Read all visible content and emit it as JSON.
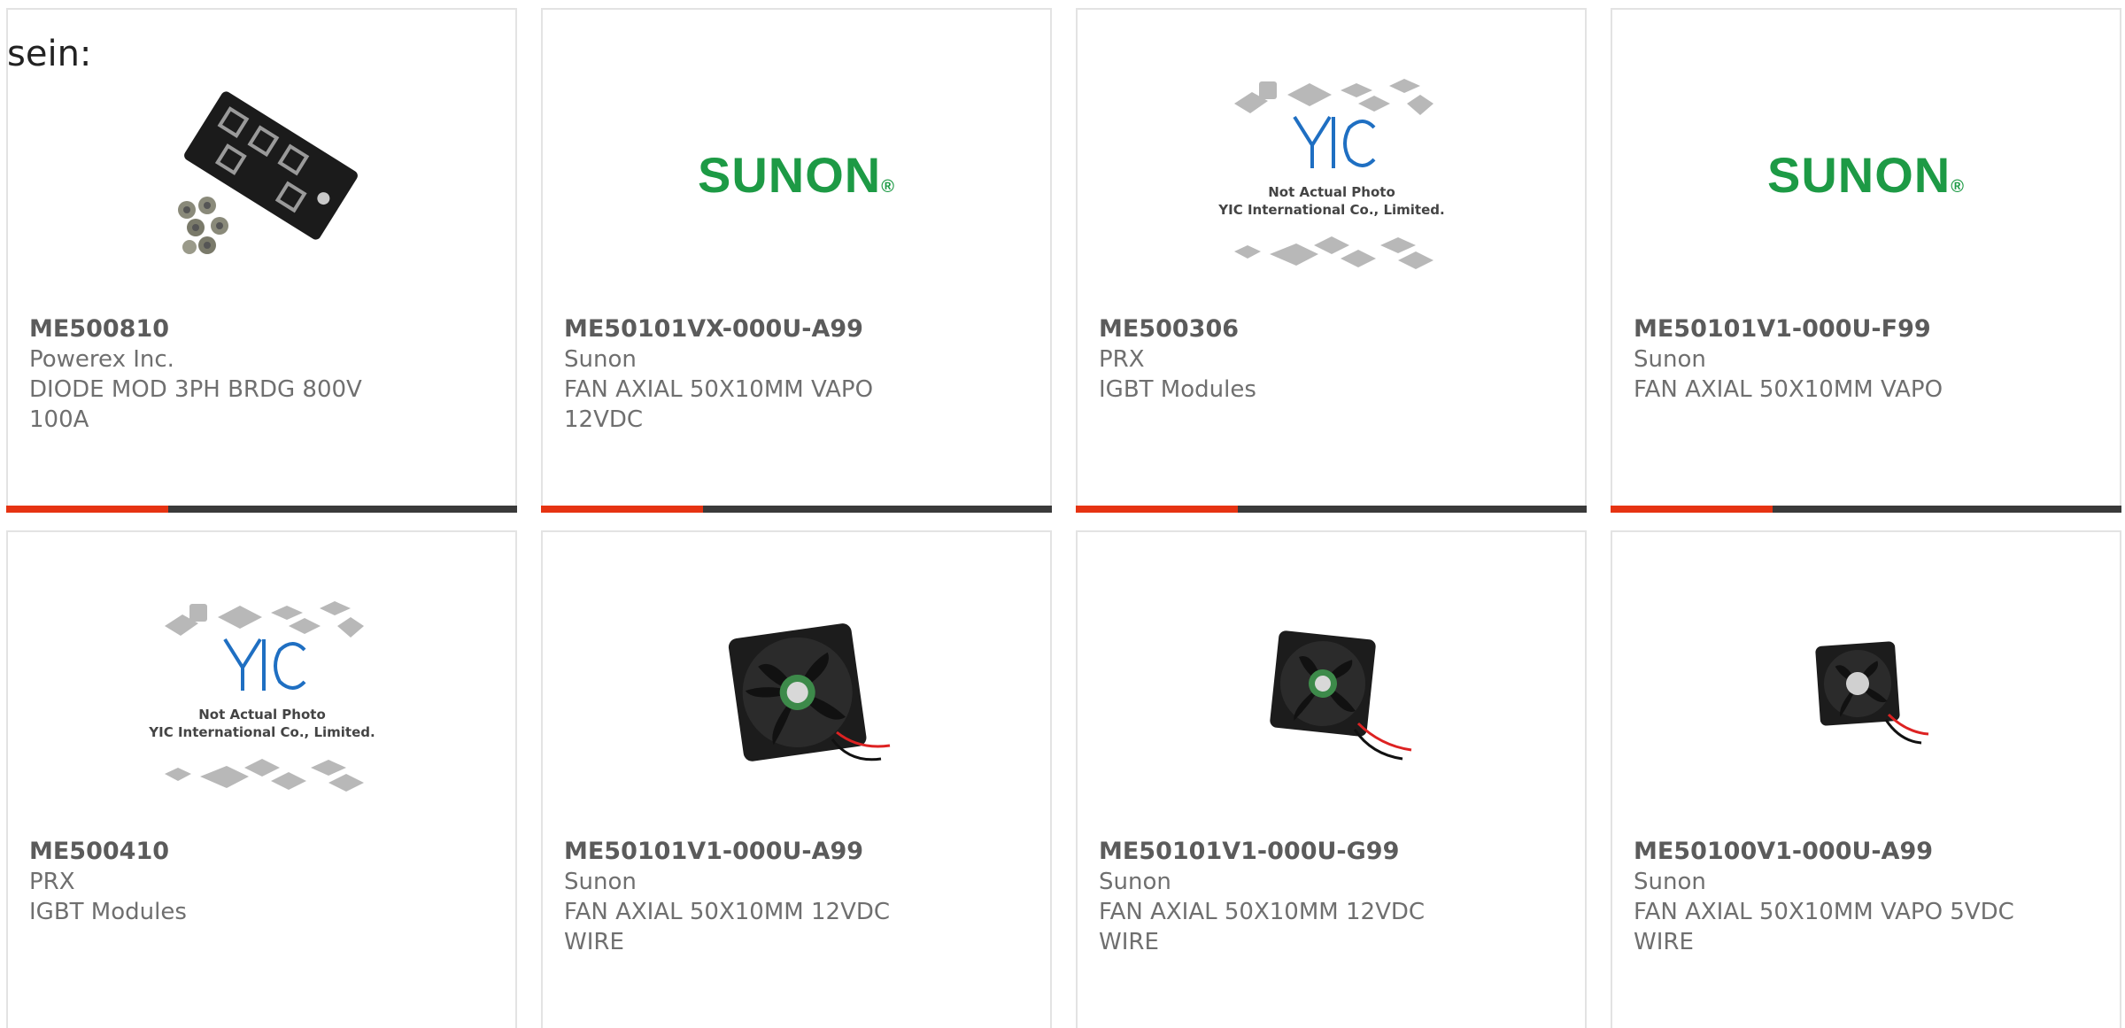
{
  "heading": "sein:",
  "products": [
    {
      "part_number": "ME500810",
      "manufacturer": "Powerex Inc.",
      "description": "DIODE MOD 3PH BRDG 800V 100A",
      "image": "diode-module-image"
    },
    {
      "part_number": "ME50101VX-000U-A99",
      "manufacturer": "Sunon",
      "description": "FAN AXIAL 50X10MM VAPO 12VDC",
      "image": "sunon-logo"
    },
    {
      "part_number": "ME500306",
      "manufacturer": "PRX",
      "description": "IGBT Modules",
      "image": "yic-placeholder"
    },
    {
      "part_number": "ME50101V1-000U-F99",
      "manufacturer": "Sunon",
      "description": "FAN AXIAL 50X10MM VAPO",
      "image": "sunon-logo"
    },
    {
      "part_number": "ME500410",
      "manufacturer": "PRX",
      "description": "IGBT Modules",
      "image": "yic-placeholder"
    },
    {
      "part_number": "ME50101V1-000U-A99",
      "manufacturer": "Sunon",
      "description": "FAN AXIAL 50X10MM 12VDC WIRE",
      "image": "fan-image"
    },
    {
      "part_number": "ME50101V1-000U-G99",
      "manufacturer": "Sunon",
      "description": "FAN AXIAL 50X10MM 12VDC WIRE",
      "image": "fan-image"
    },
    {
      "part_number": "ME50100V1-000U-A99",
      "manufacturer": "Sunon",
      "description": "FAN AXIAL 50X10MM VAPO 5VDC WIRE",
      "image": "fan-image"
    }
  ],
  "logos": {
    "sunon": "SUNON",
    "yic_line1": "Not Actual Photo",
    "yic_line2": "YIC International Co., Limited."
  },
  "colors": {
    "accent": "#e63312",
    "bar": "#3a3a3a",
    "sunon_green": "#1d9a45",
    "yic_blue": "#1f6fc2"
  }
}
